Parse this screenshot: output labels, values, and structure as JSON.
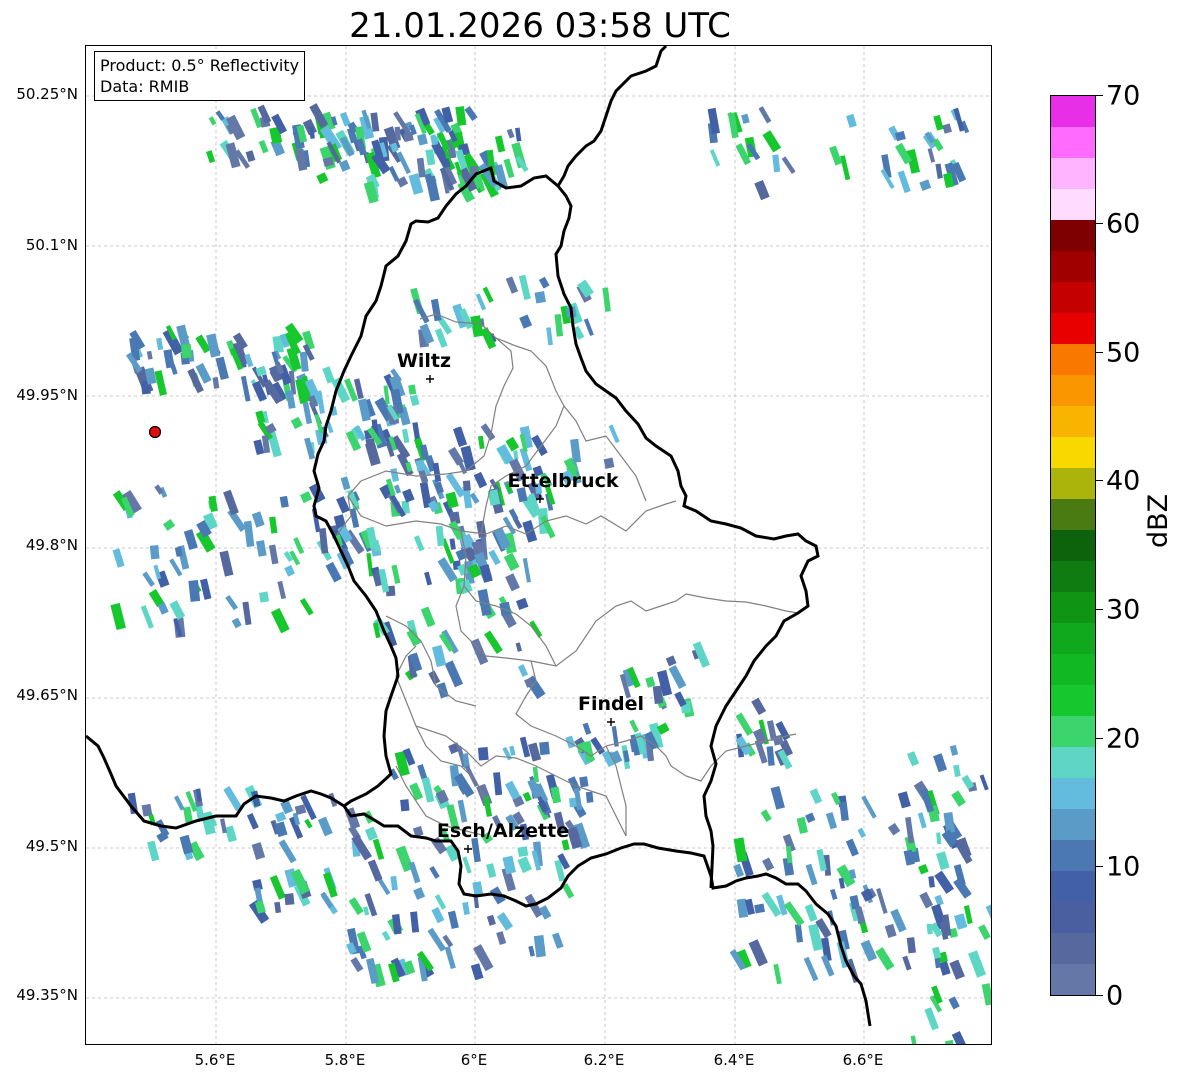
{
  "title": "21.01.2026 03:58 UTC",
  "info_box": {
    "product": "Product: 0.5° Reflectivity",
    "source": "Data: RMIB"
  },
  "map": {
    "lat_ticks": [
      "50.25°N",
      "50.1°N",
      "49.95°N",
      "49.8°N",
      "49.65°N",
      "49.5°N",
      "49.35°N"
    ],
    "lon_ticks": [
      "5.6°E",
      "5.8°E",
      "6°E",
      "6.2°E",
      "6.4°E",
      "6.6°E"
    ],
    "radar_site": "radar-marker",
    "cities": [
      {
        "name": "Wiltz"
      },
      {
        "name": "Ettelbruck"
      },
      {
        "name": "Findel"
      },
      {
        "name": "Esch/Alzette"
      }
    ]
  },
  "colorbar": {
    "label": "dBZ",
    "ticks": [
      "0",
      "10",
      "20",
      "30",
      "40",
      "50",
      "60",
      "70"
    ],
    "colors": [
      "#6478a8",
      "#56699e",
      "#4a5fa0",
      "#4160a6",
      "#4b78b3",
      "#5b9bc7",
      "#63bcdd",
      "#5dd6c6",
      "#3cd46c",
      "#16c82e",
      "#11b823",
      "#10a81c",
      "#0f9414",
      "#0e7c10",
      "#0c630c",
      "#4a7a12",
      "#aab40a",
      "#f9d800",
      "#f9b400",
      "#f99600",
      "#f97800",
      "#e80000",
      "#c40000",
      "#a00000",
      "#7e0000",
      "#ffdcff",
      "#ffb4ff",
      "#ff6aff",
      "#e62fe6"
    ]
  },
  "status_colors": {
    "border": "#000000",
    "district": "#808080",
    "radar_marker": "#e01010"
  }
}
